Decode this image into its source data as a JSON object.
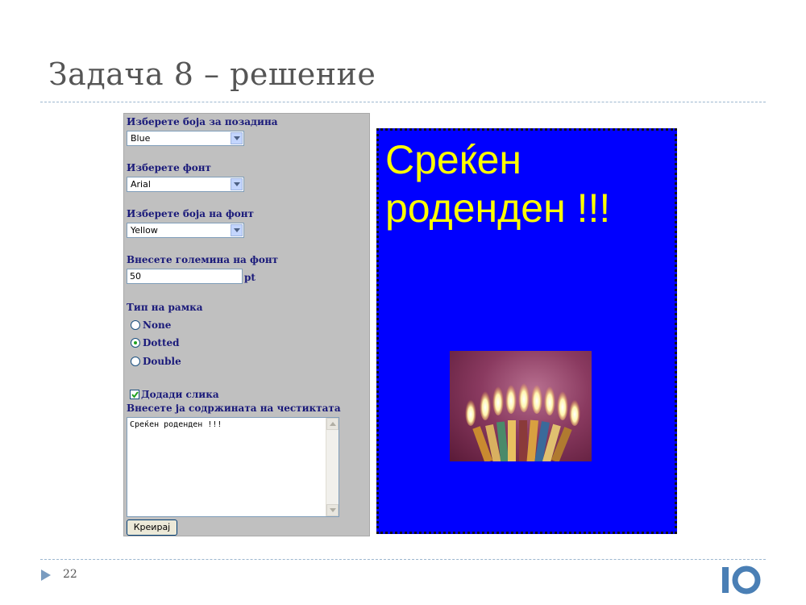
{
  "slide": {
    "title": "Задача 8 – решение",
    "page_number": "22"
  },
  "form": {
    "bg_color_label": "Изберете боја за позадина",
    "bg_color_value": "Blue",
    "font_label": "Изберете  фонт",
    "font_value": "Arial",
    "font_color_label": "Изберете боја на фонт",
    "font_color_value": "Yellow",
    "font_size_label": "Внесете големина на фонт",
    "font_size_value": "50",
    "font_size_unit": "pt",
    "border_label": "Тип на рамка",
    "border_options": [
      "None",
      "Dotted",
      "Double"
    ],
    "border_selected": "Dotted",
    "add_image_label": "Додади слика",
    "add_image_checked": true,
    "content_label": "Внесете ја содржината на честиктата",
    "content_value": "Среќен роденден !!!",
    "submit_label": "Креирај"
  },
  "card": {
    "text": "Среќен роденден !!!",
    "background_color": "#0000ff",
    "font_color": "#ffff00",
    "border_style": "dotted",
    "image": "birthday-candles"
  },
  "colors": {
    "title": "#555555",
    "rule": "#9db7cf",
    "label": "#1a1a7a",
    "logo": "#4a7fb5"
  }
}
